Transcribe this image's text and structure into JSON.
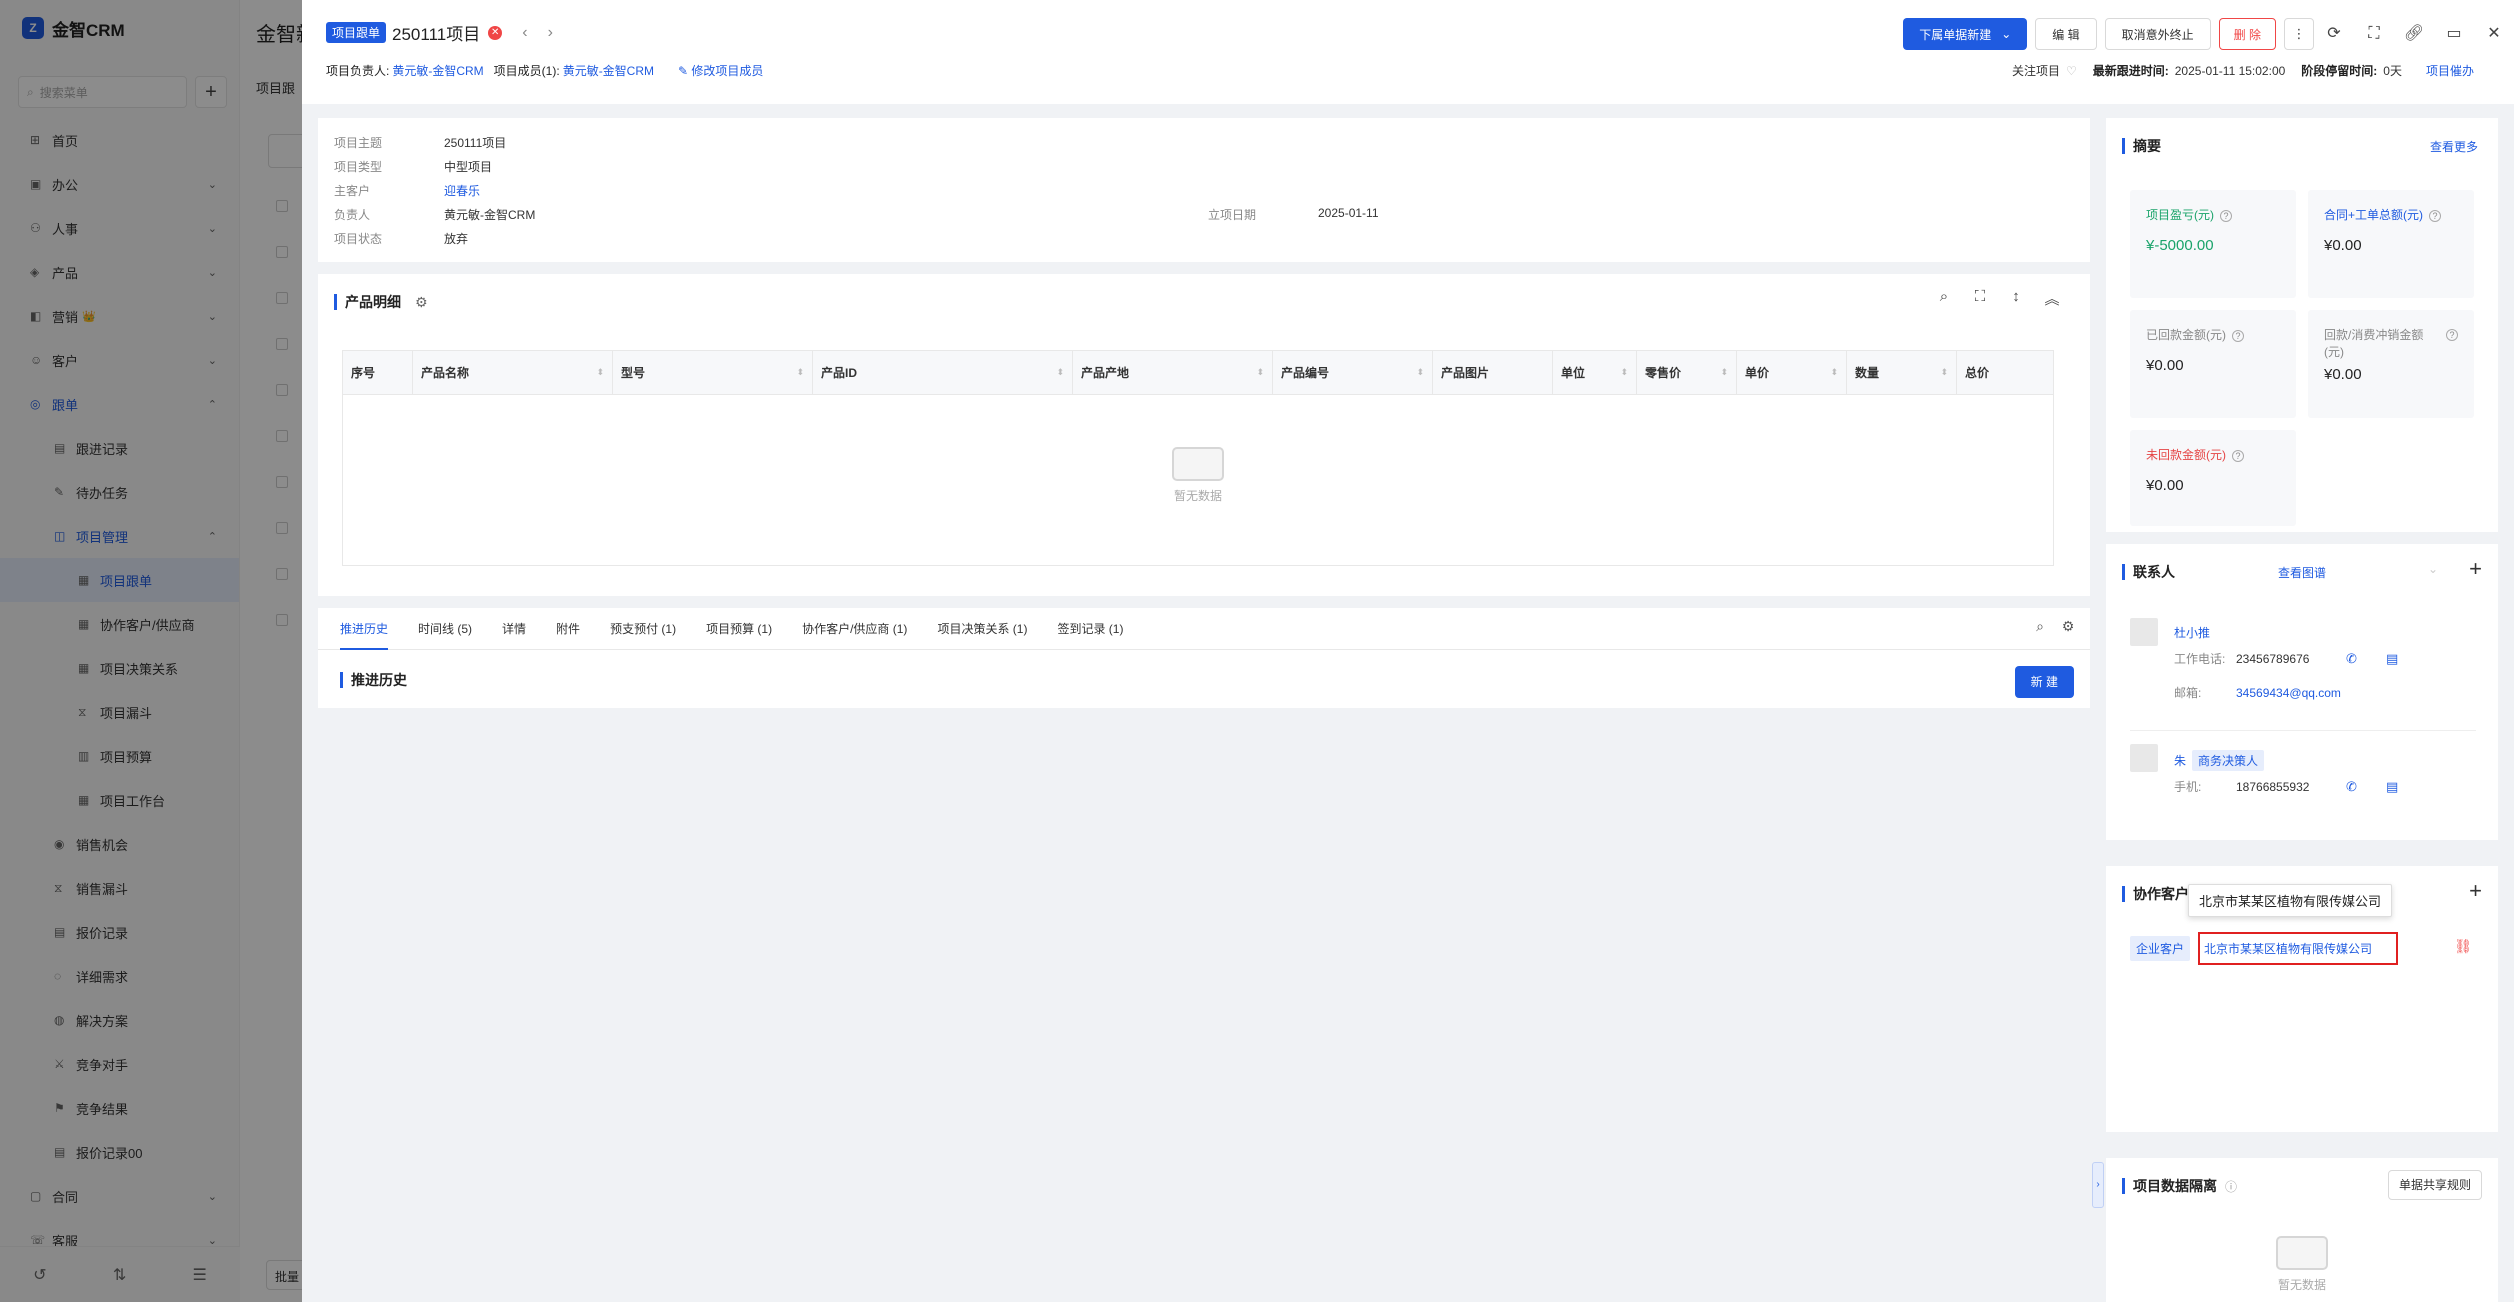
{
  "app": {
    "logo_text": "金智CRM",
    "search_placeholder": "搜索菜单",
    "bg_title": "金智新",
    "bg_subtitle": "项目跟",
    "bg_batch": "批量"
  },
  "sidebar": {
    "items": [
      {
        "label": "首页",
        "icon": "home-icon",
        "chev": ""
      },
      {
        "label": "办公",
        "icon": "office-icon",
        "chev": "⌄"
      },
      {
        "label": "人事",
        "icon": "people-icon",
        "chev": "⌄"
      },
      {
        "label": "产品",
        "icon": "product-icon",
        "chev": "⌄"
      },
      {
        "label": "营销",
        "icon": "marketing-icon",
        "chev": "⌄",
        "crown": "👑"
      },
      {
        "label": "客户",
        "icon": "customer-icon",
        "chev": "⌄"
      },
      {
        "label": "跟单",
        "icon": "follow-icon",
        "chev": "⌃"
      },
      {
        "label": "跟进记录",
        "icon": "record-icon",
        "chev": ""
      },
      {
        "label": "待办任务",
        "icon": "task-icon",
        "chev": ""
      },
      {
        "label": "项目管理",
        "icon": "project-icon",
        "chev": "⌃"
      },
      {
        "label": "项目跟单",
        "icon": "doc-icon",
        "chev": ""
      },
      {
        "label": "协作客户/供应商",
        "icon": "doc-icon",
        "chev": ""
      },
      {
        "label": "项目决策关系",
        "icon": "doc-icon",
        "chev": ""
      },
      {
        "label": "项目漏斗",
        "icon": "funnel-icon",
        "chev": ""
      },
      {
        "label": "项目预算",
        "icon": "budget-icon",
        "chev": ""
      },
      {
        "label": "项目工作台",
        "icon": "desk-icon",
        "chev": ""
      },
      {
        "label": "销售机会",
        "icon": "chance-icon",
        "chev": ""
      },
      {
        "label": "销售漏斗",
        "icon": "funnel-icon",
        "chev": ""
      },
      {
        "label": "报价记录",
        "icon": "quote-icon",
        "chev": ""
      },
      {
        "label": "详细需求",
        "icon": "demand-icon",
        "chev": ""
      },
      {
        "label": "解决方案",
        "icon": "solution-icon",
        "chev": ""
      },
      {
        "label": "竞争对手",
        "icon": "rival-icon",
        "chev": ""
      },
      {
        "label": "竞争结果",
        "icon": "result-icon",
        "chev": ""
      },
      {
        "label": "报价记录00",
        "icon": "quote-icon",
        "chev": ""
      },
      {
        "label": "合同",
        "icon": "contract-icon",
        "chev": "⌄"
      },
      {
        "label": "客服",
        "icon": "service-icon",
        "chev": "⌄"
      }
    ]
  },
  "drawer": {
    "tag": "项目跟单",
    "title": "250111项目",
    "owner_label": "项目负责人:",
    "owner": "黄元敏-金智CRM",
    "members_label": "项目成员(1):",
    "members": "黄元敏-金智CRM",
    "edit_members": "修改项目成员",
    "actions": {
      "create_sub": "下属单据新建",
      "edit": "编 辑",
      "cancel_end": "取消意外终止",
      "delete": "删 除"
    },
    "meta": {
      "follow": "关注项目",
      "last_follow_label": "最新跟进时间:",
      "last_follow": "2025-01-11 15:02:00",
      "stage_label": "阶段停留时间:",
      "stage": "0天",
      "right_link": "项目催办"
    },
    "info": {
      "subject_k": "项目主题",
      "subject_v": "250111项目",
      "type_k": "项目类型",
      "type_v": "中型项目",
      "customer_k": "主客户",
      "customer_v": "迎春乐",
      "owner_k": "负责人",
      "owner_v": "黄元敏-金智CRM",
      "date_k": "立项日期",
      "date_v": "2025-01-11",
      "status_k": "项目状态",
      "status_v": "放弃"
    },
    "products": {
      "title": "产品明细",
      "columns": [
        "序号",
        "产品名称",
        "型号",
        "产品ID",
        "产品产地",
        "产品编号",
        "产品图片",
        "单位",
        "零售价",
        "单价",
        "数量",
        "总价"
      ],
      "empty": "暂无数据"
    },
    "tabs": [
      "推进历史",
      "时间线 (5)",
      "详情",
      "附件",
      "预支预付 (1)",
      "项目预算 (1)",
      "协作客户/供应商 (1)",
      "项目决策关系 (1)",
      "签到记录 (1)"
    ],
    "history_title": "推进历史",
    "new_btn": "新 建"
  },
  "summary": {
    "title": "摘要",
    "more": "查看更多",
    "boxes": [
      {
        "label": "项目盈亏(元)",
        "value": "¥-5000.00"
      },
      {
        "label": "合同+工单总额(元)",
        "value": "¥0.00"
      },
      {
        "label": "已回款金额(元)",
        "value": "¥0.00"
      },
      {
        "label": "回款/消费冲销金额(元)",
        "value": "¥0.00"
      },
      {
        "label": "未回款金额(元)",
        "value": "¥0.00"
      }
    ]
  },
  "contacts": {
    "title": "联系人",
    "chart_link": "查看图谱",
    "list": [
      {
        "name": "杜小推",
        "role": "",
        "phone_label": "工作电话:",
        "phone": "23456789676",
        "email_label": "邮箱:",
        "email": "34569434@qq.com"
      },
      {
        "name": "朱",
        "role": "商务决策人",
        "phone_label": "手机:",
        "phone": "18766855932"
      }
    ]
  },
  "coop": {
    "title": "协作客户",
    "tag": "企业客户",
    "company": "北京市某某区植物有限传媒公司",
    "tooltip": "北京市某某区植物有限传媒公司"
  },
  "isolation": {
    "title": "项目数据隔离",
    "rule_btn": "单据共享规则",
    "empty": "暂无数据"
  },
  "colors": {
    "accent": "#1f5be0",
    "danger": "#f04646",
    "success": "#1aa36a"
  }
}
